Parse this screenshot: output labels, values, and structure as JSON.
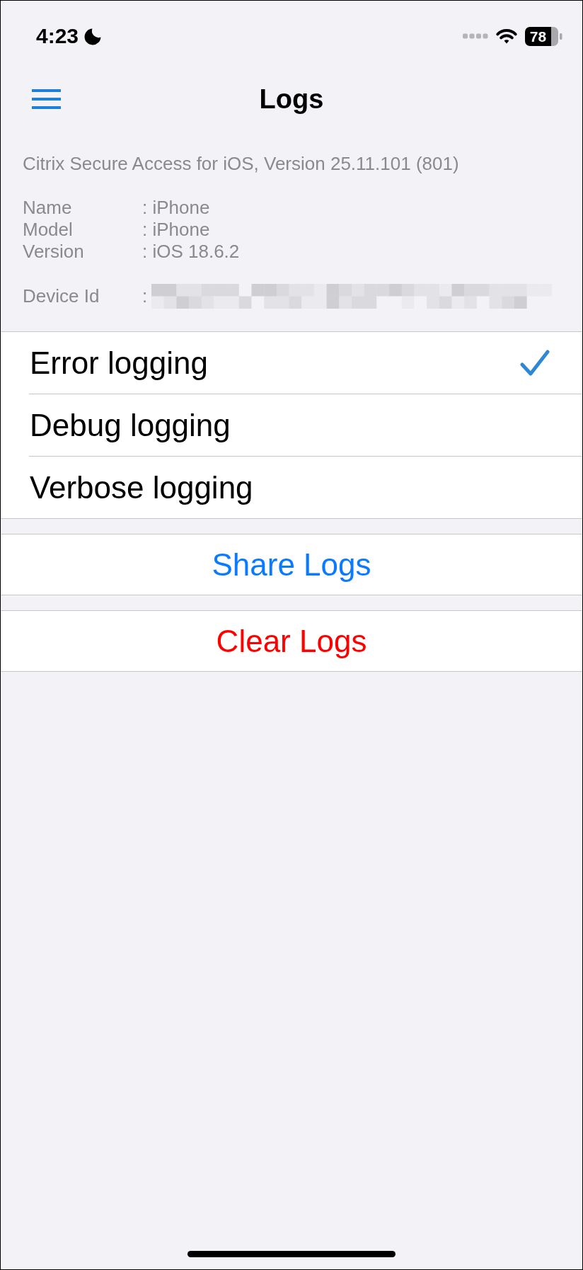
{
  "status_bar": {
    "time": "4:23",
    "battery": "78"
  },
  "nav": {
    "title": "Logs"
  },
  "app_info": "Citrix Secure Access for iOS, Version 25.11.101 (801)",
  "device_info": [
    {
      "kind": "text",
      "label": "Name",
      "value": ": iPhone"
    },
    {
      "kind": "text",
      "label": "Model",
      "value": ": iPhone"
    },
    {
      "kind": "text",
      "label": "Version",
      "value": ": iOS 18.6.2"
    },
    {
      "kind": "redacted",
      "label": "Device Id",
      "value": ":"
    }
  ],
  "log_levels": [
    {
      "label": "Error logging",
      "selected": true
    },
    {
      "label": "Debug logging",
      "selected": false
    },
    {
      "label": "Verbose logging",
      "selected": false
    }
  ],
  "actions": [
    {
      "label": "Share Logs",
      "kind": "default"
    },
    {
      "label": "Clear Logs",
      "kind": "destructive"
    }
  ]
}
